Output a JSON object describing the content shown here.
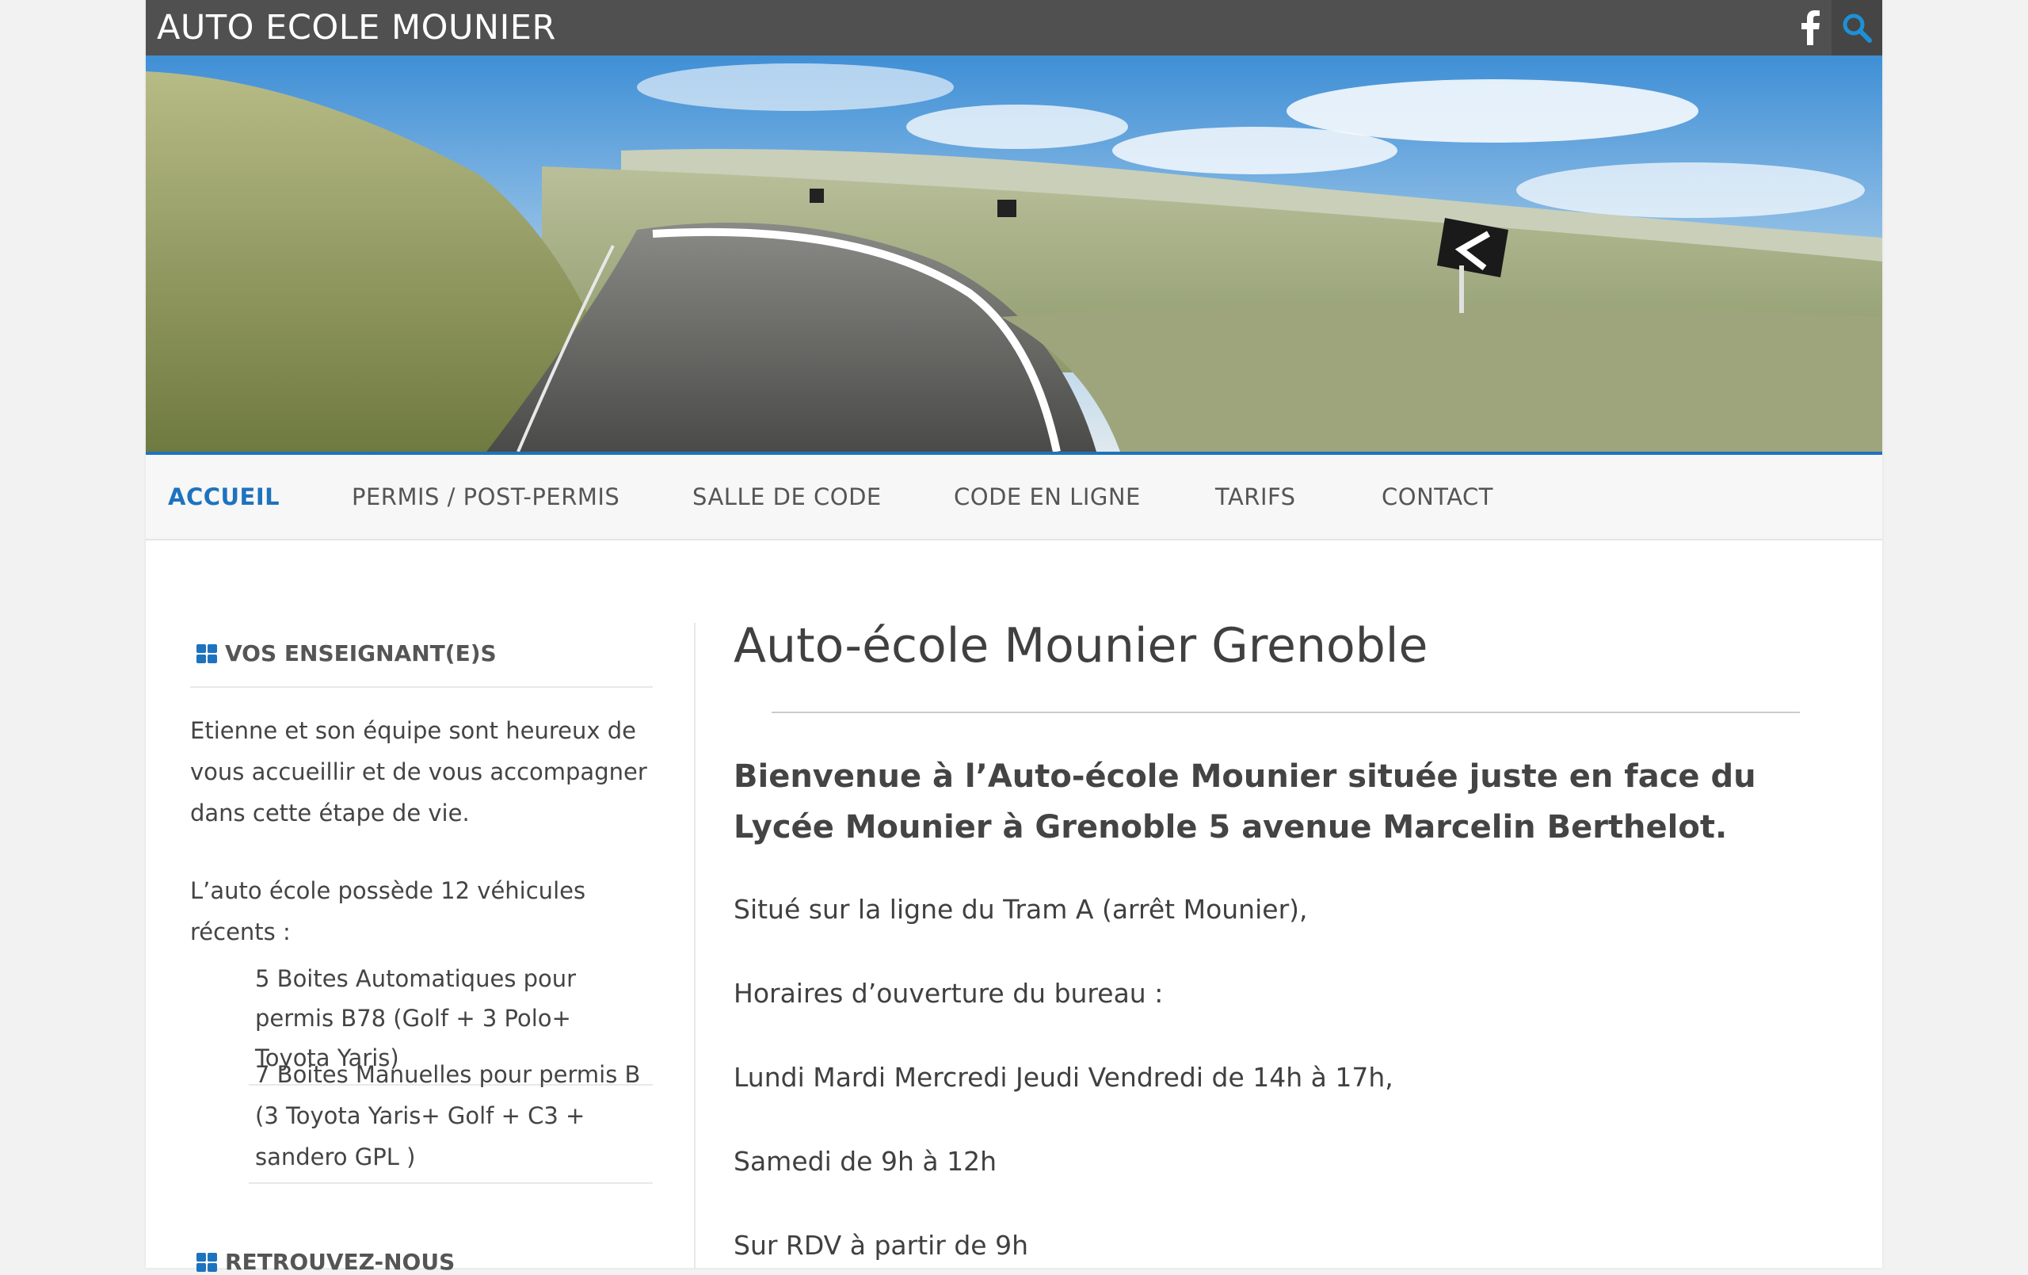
{
  "header": {
    "site_title": "AUTO ECOLE MOUNIER",
    "social_icon": "facebook-icon",
    "search_icon": "search-icon"
  },
  "colors": {
    "accent": "#1e73be",
    "topbar": "#505050",
    "nav_bg": "#f7f7f7"
  },
  "nav": {
    "items": [
      {
        "label": "ACCUEIL",
        "active": true
      },
      {
        "label": "PERMIS / POST-PERMIS",
        "active": false
      },
      {
        "label": "SALLE DE CODE",
        "active": false
      },
      {
        "label": "CODE EN LIGNE",
        "active": false
      },
      {
        "label": "TARIFS",
        "active": false
      },
      {
        "label": "CONTACT",
        "active": false
      }
    ]
  },
  "sidebar": {
    "widget1_title": "VOS ENSEIGNANT(E)S",
    "intro": "Etienne et son équipe sont heureux de vous accueillir et de vous accompagner dans cette étape de vie.",
    "fleet": "L’auto école possède 12 véhicules récents :",
    "vehicles": [
      "5 Boites Automatiques pour permis B78 (Golf +  3 Polo+ Toyota Yaris)",
      "7 Boites Manuelles pour permis B (3 Toyota Yaris+ Golf + C3 + sandero GPL )"
    ],
    "widget2_title": "RETROUVEZ-NOUS"
  },
  "main": {
    "title": "Auto-école Mounier Grenoble",
    "lead": "Bienvenue à l’Auto-école Mounier située juste en face du Lycée Mounier à Grenoble 5 avenue Marcelin Berthelot.",
    "paragraphs": [
      "Situé sur la ligne du Tram A (arrêt Mounier),",
      "Horaires d’ouverture du bureau :",
      "Lundi Mardi Mercredi Jeudi Vendredi de 14h à 17h,",
      "Samedi de 9h à 12h",
      "Sur RDV à partir de 9h"
    ]
  }
}
